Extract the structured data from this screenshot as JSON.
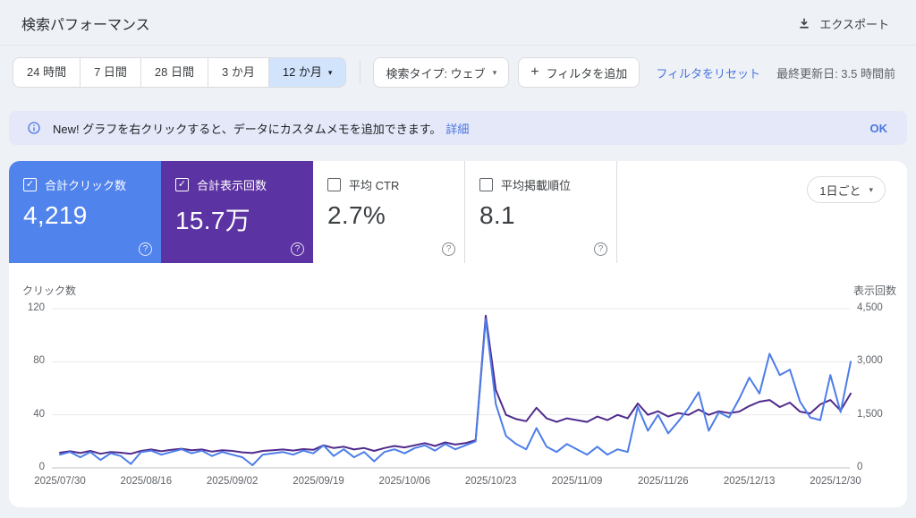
{
  "header": {
    "title": "検索パフォーマンス",
    "export_label": "エクスポート"
  },
  "toolbar": {
    "date_tabs": [
      {
        "label": "24 時間",
        "selected": false,
        "has_dropdown": false
      },
      {
        "label": "7 日間",
        "selected": false,
        "has_dropdown": false
      },
      {
        "label": "28 日間",
        "selected": false,
        "has_dropdown": false
      },
      {
        "label": "3 か月",
        "selected": false,
        "has_dropdown": false
      },
      {
        "label": "12 か月",
        "selected": true,
        "has_dropdown": true
      }
    ],
    "search_type_label": "検索タイプ: ウェブ",
    "add_filter_label": "フィルタを追加",
    "reset_filter_label": "フィルタをリセット",
    "last_updated": "最終更新日: 3.5 時間前"
  },
  "banner": {
    "text": "New! グラフを右クリックすると、データにカスタムメモを追加できます。",
    "link_label": "詳細",
    "ok_label": "OK"
  },
  "metrics": {
    "granularity_label": "1日ごと",
    "cards": [
      {
        "label": "合計クリック数",
        "value": "4,219",
        "checked": true,
        "bg": "#5183ec"
      },
      {
        "label": "合計表示回数",
        "value": "15.7万",
        "checked": true,
        "bg": "#5c33a2"
      },
      {
        "label": "平均 CTR",
        "value": "2.7%",
        "checked": false,
        "bg": "#ffffff"
      },
      {
        "label": "平均掲載順位",
        "value": "8.1",
        "checked": false,
        "bg": "#ffffff"
      }
    ]
  },
  "icons": {
    "caret": "▾",
    "plus": "+",
    "check": "✓",
    "help": "?"
  },
  "colors": {
    "clicks_accent": "#5183ec",
    "impressions_accent": "#5c33a2",
    "link_blue": "#4a75e0",
    "selected_tab_bg": "#d2e3fc",
    "banner_bg": "#e4e8f9"
  },
  "chart_data": {
    "type": "line",
    "title": "検索パフォーマンス 12か月 (1日ごと)",
    "x_start_date": "2025/07/30",
    "x_tick_labels": [
      "2025/07/30",
      "2025/08/16",
      "2025/09/02",
      "2025/09/19",
      "2025/10/06",
      "2025/10/23",
      "2025/11/09",
      "2025/11/26",
      "2025/12/13",
      "2025/12/30"
    ],
    "x_tick_days": [
      0,
      17,
      34,
      51,
      68,
      85,
      102,
      119,
      136,
      153
    ],
    "x_domain_days": [
      0,
      156
    ],
    "sample_step_days": 2,
    "grid": true,
    "left_axis": {
      "label": "クリック数",
      "range": [
        0,
        120
      ],
      "ticks": [
        0,
        40,
        80,
        120
      ],
      "tick_labels": [
        "0",
        "40",
        "80",
        "120"
      ]
    },
    "right_axis": {
      "label": "表示回数",
      "range": [
        0,
        4500
      ],
      "ticks": [
        0,
        1500,
        3000,
        4500
      ],
      "tick_labels": [
        "0",
        "1,500",
        "3,000",
        "4,500"
      ]
    },
    "series": [
      {
        "name": "表示回数",
        "axis": "right",
        "color": "#4f2a8c",
        "values": [
          430,
          470,
          420,
          480,
          400,
          450,
          430,
          400,
          480,
          520,
          470,
          510,
          540,
          500,
          520,
          460,
          500,
          480,
          440,
          420,
          480,
          500,
          520,
          490,
          530,
          510,
          640,
          560,
          600,
          520,
          560,
          480,
          560,
          620,
          580,
          640,
          700,
          620,
          720,
          660,
          700,
          780,
          4300,
          2200,
          1500,
          1380,
          1320,
          1700,
          1400,
          1300,
          1400,
          1350,
          1300,
          1450,
          1350,
          1500,
          1400,
          1820,
          1500,
          1600,
          1450,
          1550,
          1500,
          1650,
          1500,
          1600,
          1550,
          1590,
          1750,
          1870,
          1920,
          1720,
          1845,
          1590,
          1540,
          1795,
          1920,
          1620,
          2100
        ]
      },
      {
        "name": "クリック数",
        "axis": "left",
        "color": "#4c7de8",
        "values": [
          10,
          12,
          8,
          12,
          6,
          11,
          9,
          3,
          12,
          13,
          10,
          12,
          14,
          11,
          13,
          9,
          12,
          10,
          8,
          2,
          10,
          11,
          12,
          10,
          13,
          11,
          17,
          9,
          14,
          8,
          12,
          5,
          12,
          14,
          11,
          15,
          17,
          13,
          18,
          14,
          17,
          20,
          112,
          48,
          24,
          18,
          14,
          30,
          16,
          12,
          18,
          14,
          10,
          16,
          10,
          14,
          12,
          46,
          28,
          40,
          26,
          35,
          45,
          57,
          28,
          42,
          38,
          52,
          68,
          56,
          86,
          70,
          74,
          50,
          38,
          36,
          70,
          42,
          80
        ]
      }
    ]
  }
}
